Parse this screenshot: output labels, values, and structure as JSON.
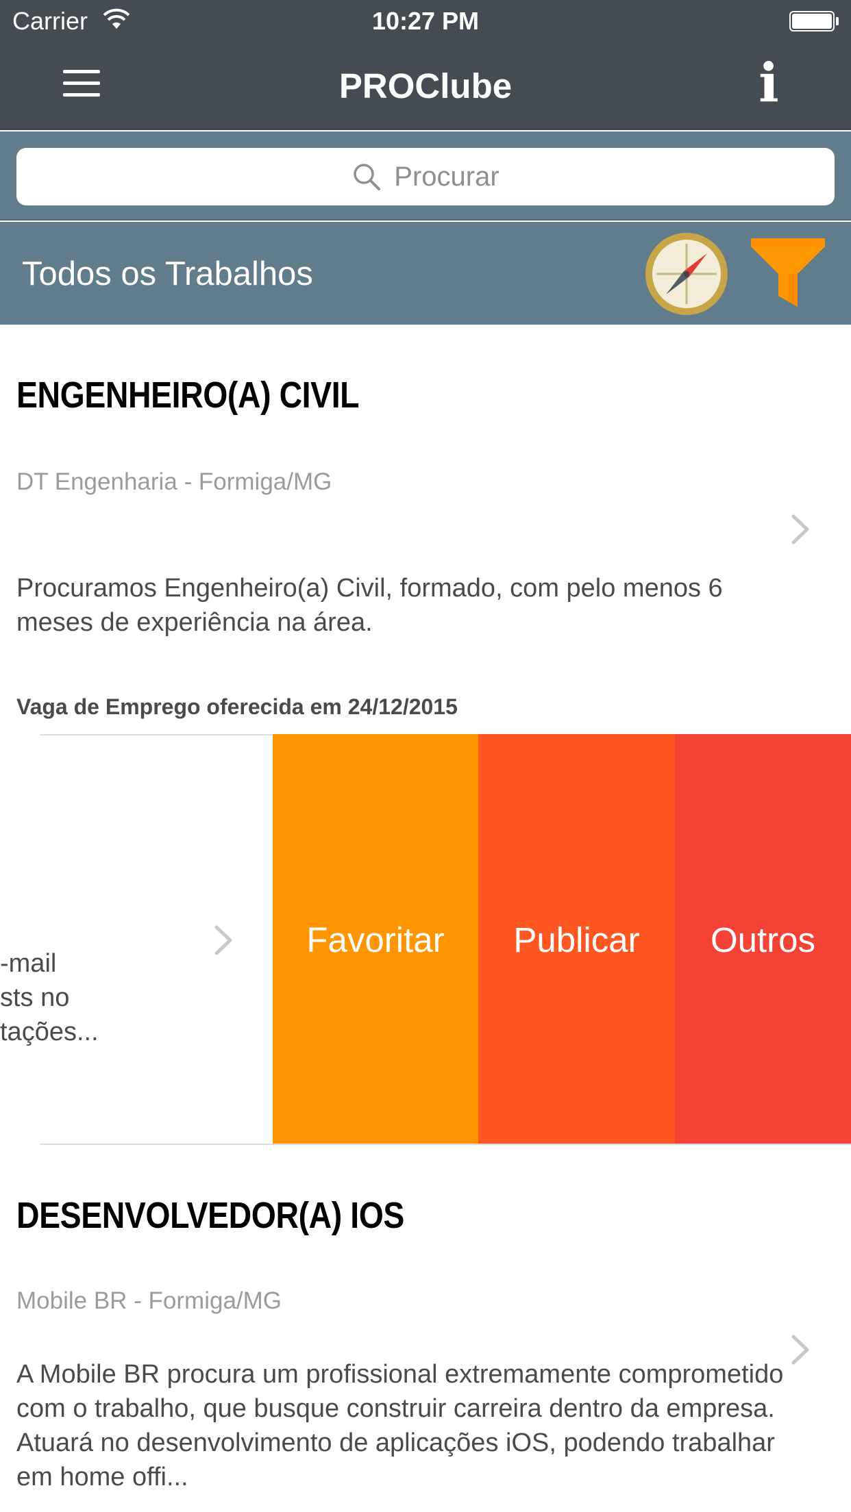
{
  "status_bar": {
    "carrier": "Carrier",
    "time": "10:27 PM"
  },
  "nav": {
    "title": "PROClube",
    "menu_icon": "hamburger-menu-icon",
    "info_label": "i"
  },
  "search": {
    "placeholder": "Procurar",
    "icon": "search-icon"
  },
  "section": {
    "title": "Todos os Trabalhos",
    "compass_icon": "compass-icon",
    "filter_icon": "filter-icon",
    "accent_color": "#617d8b"
  },
  "jobs": [
    {
      "title": "ENGENHEIRO(A) CIVIL",
      "company": "DT Engenharia - Formiga/MG",
      "description": "Procuramos Engenheiro(a) Civil, formado, com pelo menos 6 meses de experiência na área.",
      "date_line": "Vaga de Emprego oferecida em 24/12/2015"
    },
    {
      "title": "DESENVOLVEDOR(A) IOS",
      "company": "Mobile BR - Formiga/MG",
      "description": "A Mobile BR procura um profissional extremamente comprometido com o trabalho, que busque construir carreira dentro da empresa. Atuará no desenvolvimento de aplicações iOS, podendo trabalhar em home offi..."
    }
  ],
  "swiped_row": {
    "visible_text_lines": [
      "-mail",
      "sts no",
      "tações..."
    ],
    "actions": [
      {
        "label": "Favoritar",
        "color": "#ff9500"
      },
      {
        "label": "Publicar",
        "color": "#ff5722"
      },
      {
        "label": "Outros",
        "color": "#f44336"
      }
    ]
  }
}
